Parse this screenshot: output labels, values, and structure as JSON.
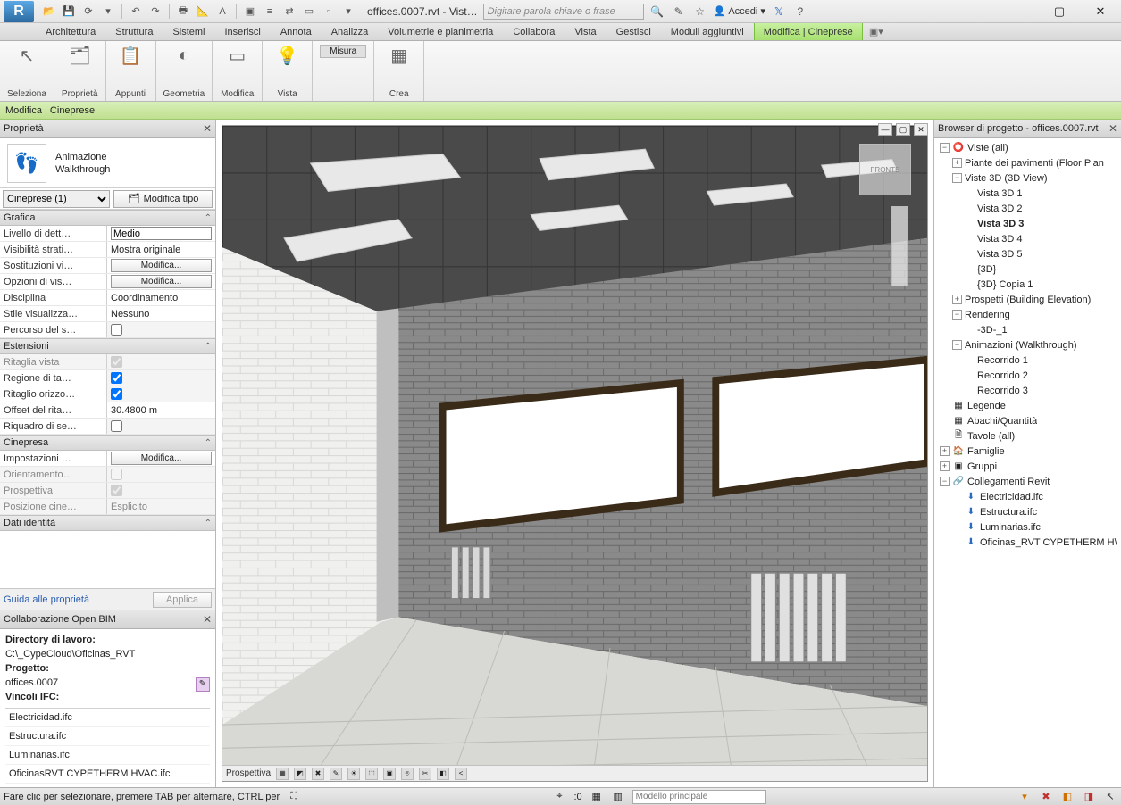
{
  "app": {
    "logo": "R",
    "title": "offices.0007.rvt - Vist…",
    "search_placeholder": "Digitare parola chiave o frase"
  },
  "signin": {
    "label": "Accedi"
  },
  "ribbon": {
    "tabs": [
      "Architettura",
      "Struttura",
      "Sistemi",
      "Inserisci",
      "Annota",
      "Analizza",
      "Volumetrie e planimetria",
      "Collabora",
      "Vista",
      "Gestisci",
      "Moduli aggiuntivi",
      "Modifica | Cineprese"
    ],
    "active": 11,
    "panels": {
      "seleziona": "Seleziona",
      "proprieta": "Proprietà",
      "appunti": "Appunti",
      "geometria": "Geometria",
      "modifica": "Modifica",
      "vista": "Vista",
      "misura": "Misura",
      "crea": "Crea"
    }
  },
  "context": {
    "label": "Modifica | Cineprese"
  },
  "properties": {
    "title": "Proprietà",
    "preview": {
      "line1": "Animazione",
      "line2": "Walkthrough"
    },
    "type_selector": "Cineprese (1)",
    "edit_type": "Modifica tipo",
    "groups": {
      "grafica": "Grafica",
      "estensioni": "Estensioni",
      "cinepresa": "Cinepresa",
      "identita": "Dati identità"
    },
    "rows": {
      "detail": {
        "k": "Livello di dett…",
        "v": "Medio"
      },
      "visibility": {
        "k": "Visibilità strati…",
        "v": "Mostra originale"
      },
      "overrides": {
        "k": "Sostituzioni vi…",
        "btn": "Modifica..."
      },
      "dispopts": {
        "k": "Opzioni di vis…",
        "btn": "Modifica..."
      },
      "disciplina": {
        "k": "Disciplina",
        "v": "Coordinamento"
      },
      "stile": {
        "k": "Stile visualizza…",
        "v": "Nessuno"
      },
      "percorso": {
        "k": "Percorso del s…",
        "chk": false
      },
      "ritaglia": {
        "k": "Ritaglia vista",
        "chk": true
      },
      "regione": {
        "k": "Regione di ta…",
        "chk": true
      },
      "ritaglioh": {
        "k": "Ritaglio orizzo…",
        "chk": true
      },
      "offset": {
        "k": "Offset del rita…",
        "v": "30.4800 m"
      },
      "riquadro": {
        "k": "Riquadro di se…",
        "chk": false
      },
      "impostazioni": {
        "k": "Impostazioni …",
        "btn": "Modifica..."
      },
      "orientamento": {
        "k": "Orientamento…",
        "chk": false
      },
      "prospettiva": {
        "k": "Prospettiva",
        "chk": true
      },
      "posizione": {
        "k": "Posizione cine…",
        "v": "Esplicito"
      }
    },
    "footer": {
      "help": "Guida alle proprietà",
      "apply": "Applica"
    }
  },
  "bim": {
    "title": "Collaborazione Open BIM",
    "dir_label": "Directory di lavoro:",
    "dir_value": "C:\\_CypeCloud\\Oficinas_RVT",
    "project_label": "Progetto:",
    "project_value": "offices.0007",
    "ifc_label": "Vincoli IFC:",
    "items": [
      "Electricidad.ifc",
      "Estructura.ifc",
      "Luminarias.ifc",
      "OficinasRVT CYPETHERM HVAC.ifc"
    ]
  },
  "viewport": {
    "perspective": "Prospettiva",
    "cube": "FRONTE"
  },
  "browser": {
    "title": "Browser di progetto - offices.0007.rvt",
    "viste_all": "Viste (all)",
    "floorplans": "Piante dei pavimenti (Floor Plan",
    "views3d": "Viste 3D (3D View)",
    "v3d": [
      "Vista 3D 1",
      "Vista 3D 2",
      "Vista 3D 3",
      "Vista 3D 4",
      "Vista 3D 5",
      "{3D}",
      "{3D} Copia 1"
    ],
    "v3d_active": 2,
    "prospetti": "Prospetti (Building Elevation)",
    "rendering": "Rendering",
    "rendering_child": "-3D-_1",
    "animazioni": "Animazioni (Walkthrough)",
    "recorridos": [
      "Recorrido 1",
      "Recorrido 2",
      "Recorrido 3"
    ],
    "legende": "Legende",
    "abachi": "Abachi/Quantità",
    "tavole": "Tavole (all)",
    "famiglie": "Famiglie",
    "gruppi": "Gruppi",
    "collegamenti": "Collegamenti Revit",
    "links": [
      "Electricidad.ifc",
      "Estructura.ifc",
      "Luminarias.ifc",
      "Oficinas_RVT CYPETHERM H\\"
    ]
  },
  "status": {
    "hint": "Fare clic per selezionare, premere TAB per alternare, CTRL per",
    "zero": ":0",
    "model": "Modello principale"
  }
}
